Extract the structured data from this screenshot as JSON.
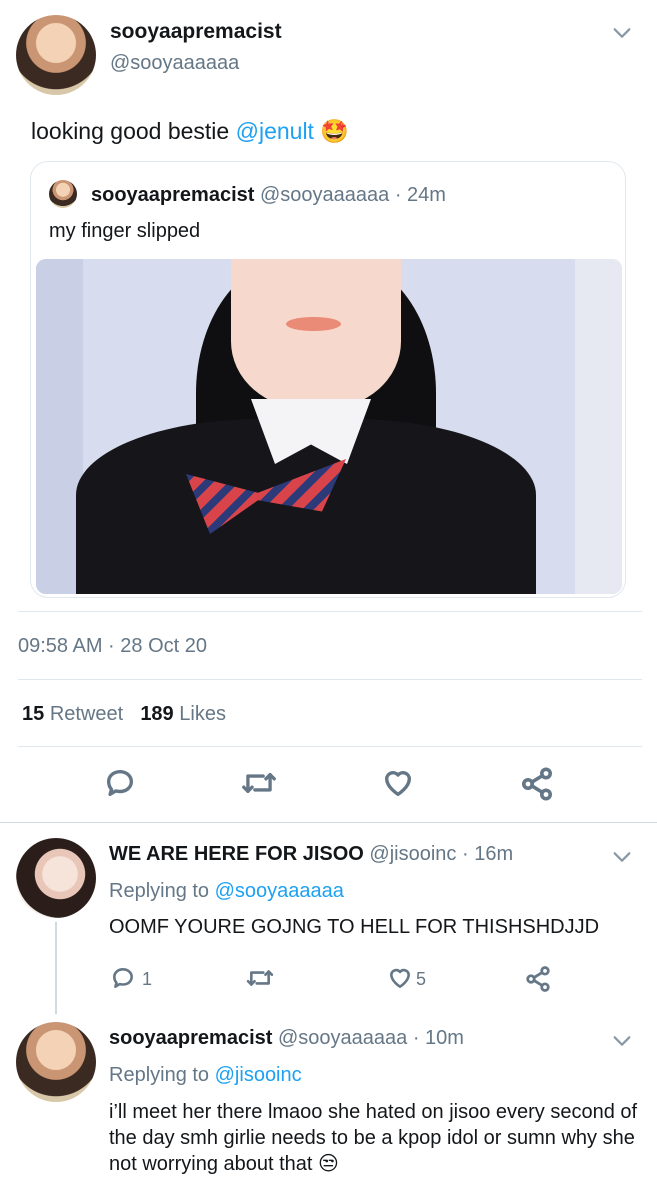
{
  "main_tweet": {
    "author_name": "sooyaapremacist",
    "author_handle": "@sooyaaaaaa",
    "text_prefix": "looking good bestie ",
    "mention": "@jenult",
    "emoji": "🤩",
    "timestamp": "09:58 AM · 28 Oct 20",
    "retweet_count": "15",
    "retweet_label": "Retweet",
    "likes_count": "189",
    "likes_label": "Likes"
  },
  "quoted_tweet": {
    "author_name": "sooyaapremacist",
    "author_handle": "@sooyaaaaaa",
    "time": "· 24m",
    "text": "my finger slipped"
  },
  "replies": [
    {
      "author_name": "WE ARE HERE FOR JISOO",
      "author_handle": "@jisooinc",
      "time": "· 16m",
      "replying_label": "Replying to ",
      "replying_to": "@sooyaaaaaa",
      "text": "OOMF YOURE GOJNG TO HELL FOR THISHSHDJJD",
      "reply_count": "1",
      "like_count": "5"
    },
    {
      "author_name": "sooyaapremacist",
      "author_handle": "@sooyaaaaaa",
      "time": "· 10m",
      "replying_label": "Replying to ",
      "replying_to": "@jisooinc",
      "text": "i’ll meet her there lmaoo she hated on jisoo every second of the day smh girlie needs to be a kpop idol or sumn why she not worrying about that 😒"
    }
  ],
  "icons": [
    "chevron-down-icon",
    "reply-icon",
    "retweet-icon",
    "like-icon",
    "share-icon"
  ],
  "colors": {
    "link": "#1da1f2",
    "muted": "#657786",
    "divider": "#e1e8ed"
  }
}
